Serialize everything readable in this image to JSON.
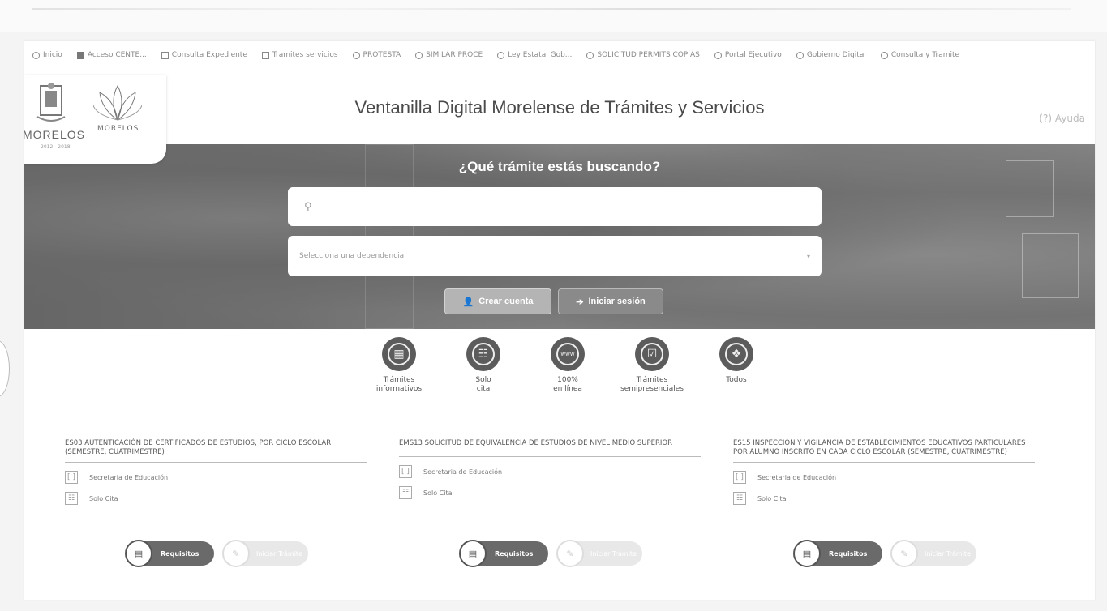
{
  "bookmarks": [
    {
      "label": "Inicio",
      "icon": "globe-icon"
    },
    {
      "label": "Acceso CENTE...",
      "icon": "square-icon"
    },
    {
      "label": "Consulta Expediente",
      "icon": "doc-icon"
    },
    {
      "label": "Tramites servicios",
      "icon": "doc-icon"
    },
    {
      "label": "PROTESTA",
      "icon": "globe-icon"
    },
    {
      "label": "SIMILAR PROCE",
      "icon": "globe-icon"
    },
    {
      "label": "Ley Estatal Gob...",
      "icon": "globe-icon"
    },
    {
      "label": "SOLICITUD PERMITS COPIAS",
      "icon": "globe-icon"
    },
    {
      "label": "Portal Ejecutivo",
      "icon": "globe-icon"
    },
    {
      "label": "Gobierno Digital",
      "icon": "globe-icon"
    },
    {
      "label": "Consulta y Tramite",
      "icon": "globe-icon"
    }
  ],
  "logos": {
    "state_text": "MORELOS",
    "state_sub": "2012 - 2018",
    "brand_text": "MORELOS"
  },
  "header": {
    "title": "Ventanilla Digital Morelense de Trámites y Servicios",
    "help": "(?) Ayuda"
  },
  "hero": {
    "question": "¿Qué trámite estás buscando?",
    "search_placeholder": "",
    "select_placeholder": "Selecciona una dependencia",
    "create_label": "Crear cuenta",
    "login_label": "Iniciar sesión"
  },
  "categories": [
    {
      "line1": "Trámites",
      "line2": "informativos",
      "icon": "calculator-icon"
    },
    {
      "line1": "Solo",
      "line2": "cita",
      "icon": "calendar-icon"
    },
    {
      "line1": "100%",
      "line2": "en línea",
      "icon": "www-icon"
    },
    {
      "line1": "Trámites",
      "line2": "semipresenciales",
      "icon": "person-icon"
    },
    {
      "line1": "Todos",
      "line2": "",
      "icon": "cube-icon"
    }
  ],
  "cards": [
    {
      "title": "ES03 AUTENTICACIÓN DE CERTIFICADOS DE ESTUDIOS, POR CICLO ESCOLAR (SEMESTRE, CUATRIMESTRE)",
      "dependency": "Secretaria de Educación",
      "modality": "Solo Cita",
      "req_label": "Requisitos",
      "init_label": "Iniciar Trámite"
    },
    {
      "title": "EMS13 SOLICITUD DE EQUIVALENCIA DE ESTUDIOS DE NIVEL MEDIO SUPERIOR",
      "dependency": "Secretaria de Educación",
      "modality": "Solo Cita",
      "req_label": "Requisitos",
      "init_label": "Iniciar Trámite"
    },
    {
      "title": "ES15 INSPECCIÓN Y VIGILANCIA DE ESTABLECIMIENTOS EDUCATIVOS PARTICULARES POR ALUMNO INSCRITO EN CADA CICLO ESCOLAR (SEMESTRE, CUATRIMESTRE)",
      "dependency": "Secretaria de Educación",
      "modality": "Solo Cita",
      "req_label": "Requisitos",
      "init_label": "Iniciar Trámite"
    }
  ]
}
